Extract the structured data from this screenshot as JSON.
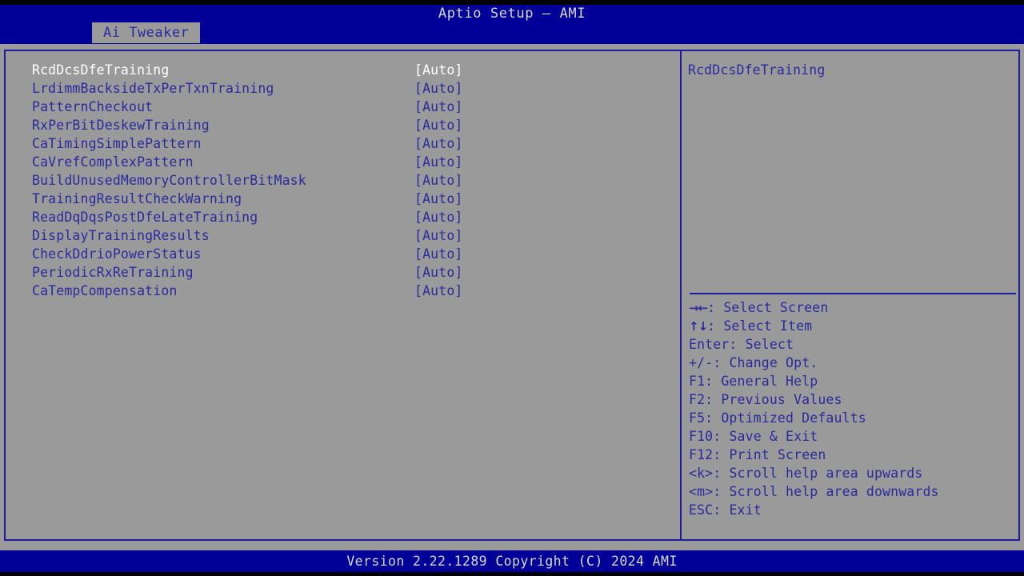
{
  "app": {
    "title": "Aptio Setup – AMI",
    "colors": {
      "blue_bar": "#000099",
      "panel_bg": "#9a9a9a",
      "text_blue": "#2a2a9c",
      "text_selected": "#ffffff",
      "border_blue": "#1c1c9c",
      "header_text": "#d8d8d8"
    }
  },
  "tabs": [
    {
      "label": "Ai Tweaker",
      "active": true
    }
  ],
  "settings": [
    {
      "name": "RcdDcsDfeTraining",
      "value": "[Auto]",
      "selected": true
    },
    {
      "name": "LrdimmBacksideTxPerTxnTraining",
      "value": "[Auto]",
      "selected": false
    },
    {
      "name": "PatternCheckout",
      "value": "[Auto]",
      "selected": false
    },
    {
      "name": "RxPerBitDeskewTraining",
      "value": "[Auto]",
      "selected": false
    },
    {
      "name": "CaTimingSimplePattern",
      "value": "[Auto]",
      "selected": false
    },
    {
      "name": "CaVrefComplexPattern",
      "value": "[Auto]",
      "selected": false
    },
    {
      "name": "BuildUnusedMemoryControllerBitMask",
      "value": "[Auto]",
      "selected": false
    },
    {
      "name": "TrainingResultCheckWarning",
      "value": "[Auto]",
      "selected": false
    },
    {
      "name": "ReadDqDqsPostDfeLateTraining",
      "value": "[Auto]",
      "selected": false
    },
    {
      "name": "DisplayTrainingResults",
      "value": "[Auto]",
      "selected": false
    },
    {
      "name": "CheckDdrioPowerStatus",
      "value": "[Auto]",
      "selected": false
    },
    {
      "name": "PeriodicRxReTraining",
      "value": "[Auto]",
      "selected": false
    },
    {
      "name": "CaTempCompensation",
      "value": "[Auto]",
      "selected": false
    }
  ],
  "help": {
    "description": "RcdDcsDfeTraining"
  },
  "legend": [
    {
      "key": "→←",
      "sep": ": ",
      "action": "Select Screen",
      "arrow": true
    },
    {
      "key": "↑↓",
      "sep": ": ",
      "action": "Select Item",
      "arrow": true
    },
    {
      "key": "Enter",
      "sep": ": ",
      "action": "Select",
      "arrow": false
    },
    {
      "key": "+/-",
      "sep": ": ",
      "action": "Change Opt.",
      "arrow": false
    },
    {
      "key": "F1",
      "sep": ": ",
      "action": "General Help",
      "arrow": false
    },
    {
      "key": "F2",
      "sep": ": ",
      "action": "Previous Values",
      "arrow": false
    },
    {
      "key": "F5",
      "sep": ": ",
      "action": "Optimized Defaults",
      "arrow": false
    },
    {
      "key": "F10",
      "sep": ": ",
      "action": "Save & Exit",
      "arrow": false
    },
    {
      "key": "F12",
      "sep": ": ",
      "action": "Print Screen",
      "arrow": false
    },
    {
      "key": "<k>",
      "sep": ": ",
      "action": "Scroll help area upwards",
      "arrow": false
    },
    {
      "key": "<m>",
      "sep": ": ",
      "action": "Scroll help area downwards",
      "arrow": false
    },
    {
      "key": "ESC",
      "sep": ": ",
      "action": "Exit",
      "arrow": false
    }
  ],
  "footer": {
    "version_text": "Version 2.22.1289 Copyright (C) 2024 AMI"
  }
}
